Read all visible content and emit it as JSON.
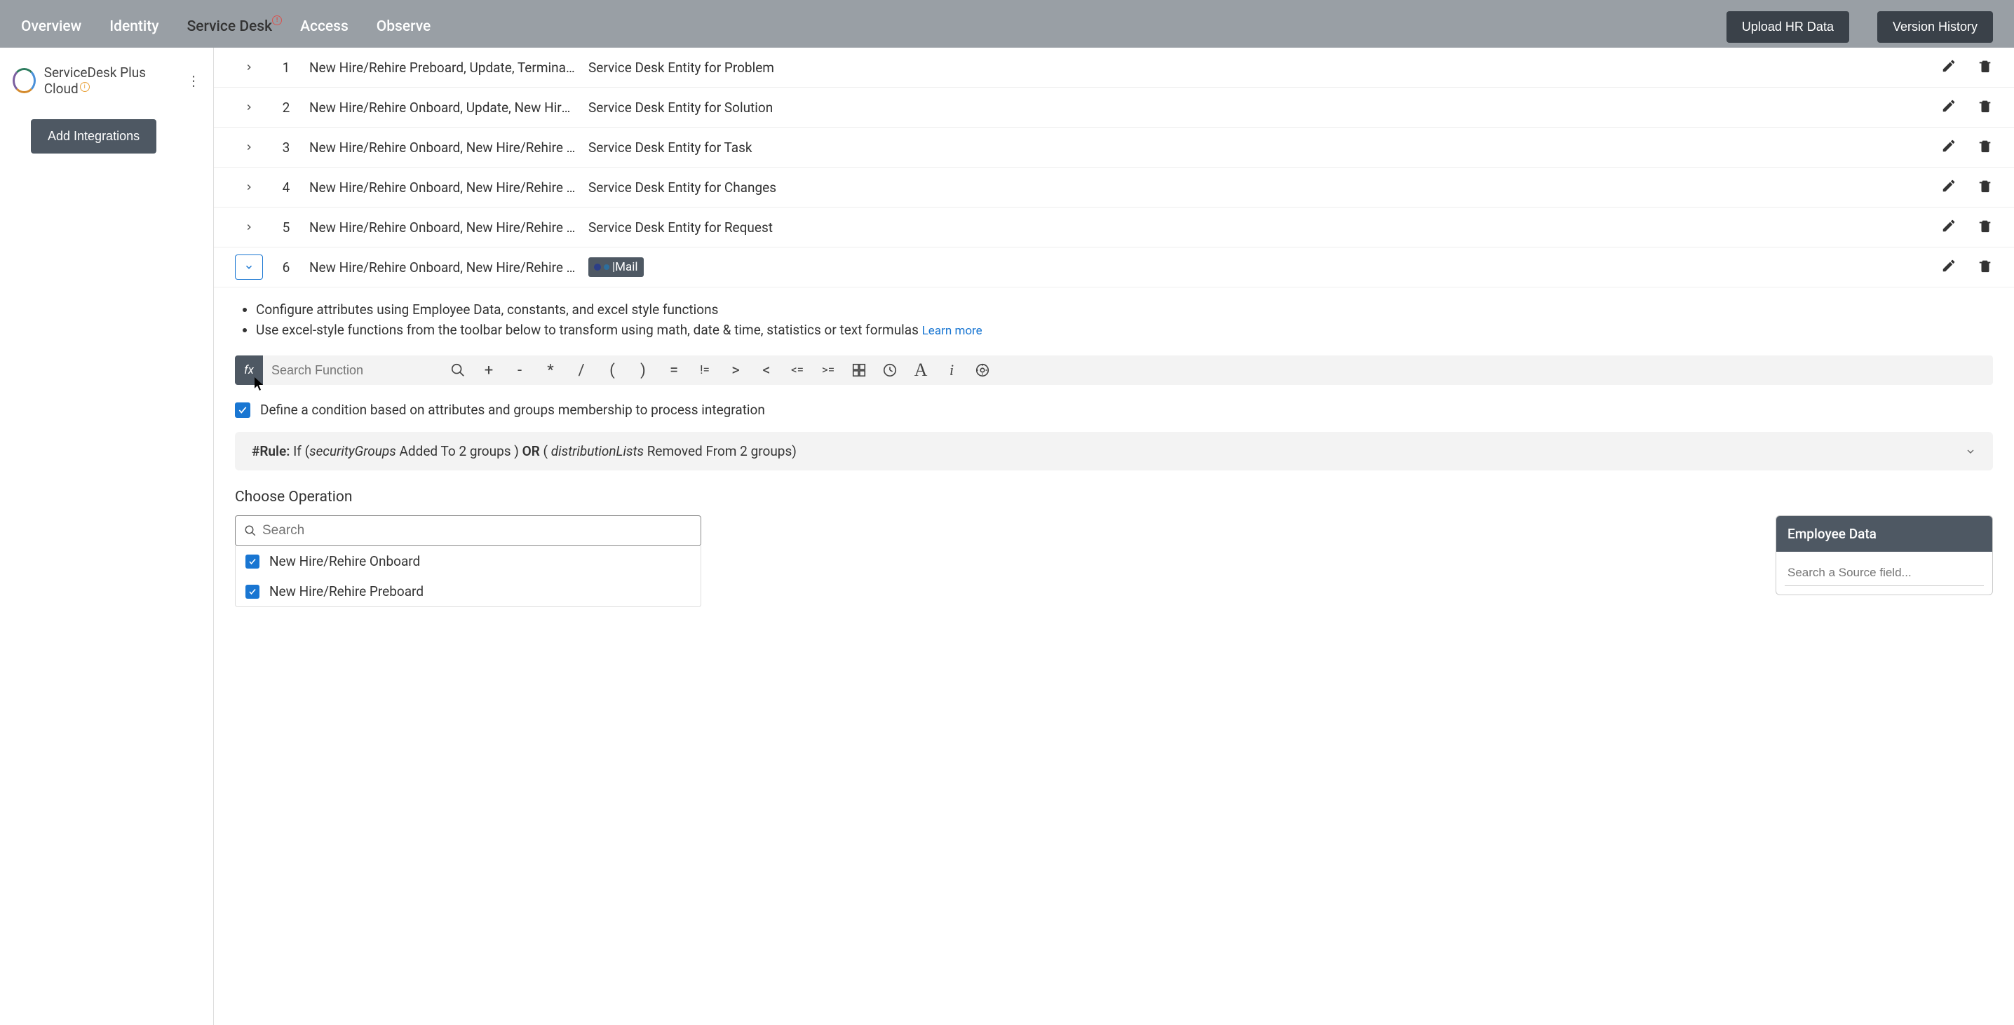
{
  "nav": {
    "items": [
      "Overview",
      "Identity",
      "Service Desk",
      "Access",
      "Observe"
    ],
    "active_index": 2,
    "upload_btn": "Upload HR Data",
    "version_btn": "Version History"
  },
  "sidebar": {
    "title": "ServiceDesk Plus Cloud",
    "add_btn": "Add Integrations"
  },
  "rows": [
    {
      "num": "1",
      "col1": "New Hire/Rehire Preboard, Update, Terminate, Lon..",
      "warn": true,
      "col2": "Service Desk Entity for Problem",
      "expanded": false
    },
    {
      "num": "2",
      "col1": "New Hire/Rehire Onboard, Update, New Hire/Rehir…",
      "warn": false,
      "col2": "Service Desk Entity for Solution",
      "expanded": false
    },
    {
      "num": "3",
      "col1": "New Hire/Rehire Onboard, New Hire/Rehire Prebo…",
      "warn": true,
      "col2": "Service Desk Entity for Task",
      "expanded": false
    },
    {
      "num": "4",
      "col1": "New Hire/Rehire Onboard, New Hire/Rehire Prebo…",
      "warn": false,
      "col2": "Service Desk Entity for Changes",
      "expanded": false
    },
    {
      "num": "5",
      "col1": "New Hire/Rehire Onboard, New Hire/Rehire Prebo…",
      "warn": false,
      "col2": "Service Desk Entity for Request",
      "expanded": false
    },
    {
      "num": "6",
      "col1": "New Hire/Rehire Onboard, New Hire/Rehire Prebo…",
      "warn": false,
      "col2_badge": "|Mail",
      "expanded": true
    }
  ],
  "config": {
    "line1": "Configure attributes using Employee Data, constants, and excel style functions",
    "line2": "Use excel-style functions from the toolbar below to transform using math, date & time, statistics or text formulas",
    "learn_more": "Learn more",
    "search_placeholder": "Search Function",
    "fx_label": "fx",
    "operators": [
      "+",
      "-",
      "*",
      "/",
      "(",
      ")",
      "=",
      "!=",
      ">",
      "<",
      "<=",
      ">="
    ]
  },
  "condition": {
    "checked": true,
    "label": "Define a condition based on attributes and groups membership to process integration"
  },
  "rule": {
    "prefix": "#Rule:",
    "if": "If (",
    "sg": "securityGroups",
    "added": " Added To 2 groups ) ",
    "or": "OR",
    "dl_open": " ( ",
    "dl": "distributionLists",
    "removed": " Removed From 2 groups)"
  },
  "choose_op": {
    "title": "Choose Operation",
    "search_placeholder": "Search",
    "items": [
      {
        "label": "New Hire/Rehire Onboard",
        "checked": true
      },
      {
        "label": "New Hire/Rehire Preboard",
        "checked": true
      }
    ]
  },
  "emp_panel": {
    "title": "Employee Data",
    "search_placeholder": "Search a Source field..."
  }
}
